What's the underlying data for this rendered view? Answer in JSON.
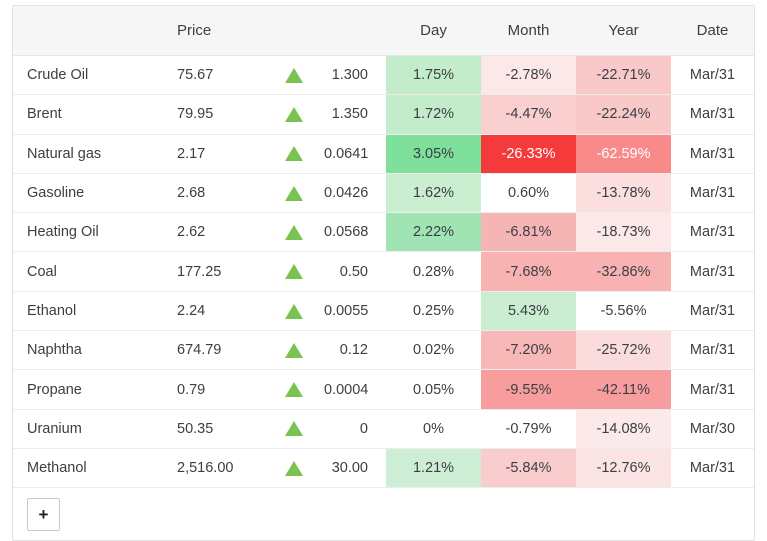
{
  "table": {
    "headers": {
      "name": "",
      "price": "Price",
      "arrow": "",
      "change": "",
      "day": "Day",
      "month": "Month",
      "year": "Year",
      "date": "Date"
    },
    "rows": [
      {
        "name": "Crude Oil",
        "price": "75.67",
        "direction": "up",
        "change": "1.300",
        "day": "1.75%",
        "month": "-2.78%",
        "year": "-22.71%",
        "date": "Mar/31",
        "day_bg": "#c3ecca",
        "month_bg": "#fce8e8",
        "year_bg": "#f9c9c9",
        "day_fg": "#3a3f44",
        "month_fg": "#3a3f44",
        "year_fg": "#3a3f44"
      },
      {
        "name": "Brent",
        "price": "79.95",
        "direction": "up",
        "change": "1.350",
        "day": "1.72%",
        "month": "-4.47%",
        "year": "-22.24%",
        "date": "Mar/31",
        "day_bg": "#c3ecca",
        "month_bg": "#f9cfcf",
        "year_bg": "#f9c9c9",
        "day_fg": "#3a3f44",
        "month_fg": "#3a3f44",
        "year_fg": "#3a3f44"
      },
      {
        "name": "Natural gas",
        "price": "2.17",
        "direction": "up",
        "change": "0.0641",
        "day": "3.05%",
        "month": "-26.33%",
        "year": "-62.59%",
        "date": "Mar/31",
        "day_bg": "#7ee09a",
        "month_bg": "#f43a3a",
        "year_bg": "#f98a8a",
        "day_fg": "#3a3f44",
        "month_fg": "#ffffff",
        "year_fg": "#ffffff"
      },
      {
        "name": "Gasoline",
        "price": "2.68",
        "direction": "up",
        "change": "0.0426",
        "day": "1.62%",
        "month": "0.60%",
        "year": "-13.78%",
        "date": "Mar/31",
        "day_bg": "#c9eed0",
        "month_bg": "#ffffff",
        "year_bg": "#fbdede",
        "day_fg": "#3a3f44",
        "month_fg": "#3a3f44",
        "year_fg": "#3a3f44"
      },
      {
        "name": "Heating Oil",
        "price": "2.62",
        "direction": "up",
        "change": "0.0568",
        "day": "2.22%",
        "month": "-6.81%",
        "year": "-18.73%",
        "date": "Mar/31",
        "day_bg": "#9fe4b2",
        "month_bg": "#f6b5b5",
        "year_bg": "#fce8e8",
        "day_fg": "#3a3f44",
        "month_fg": "#3a3f44",
        "year_fg": "#3a3f44"
      },
      {
        "name": "Coal",
        "price": "177.25",
        "direction": "up",
        "change": "0.50",
        "day": "0.28%",
        "month": "-7.68%",
        "year": "-32.86%",
        "date": "Mar/31",
        "day_bg": "#ffffff",
        "month_bg": "#f8b2b2",
        "year_bg": "#f8b2b2",
        "day_fg": "#3a3f44",
        "month_fg": "#3a3f44",
        "year_fg": "#3a3f44"
      },
      {
        "name": "Ethanol",
        "price": "2.24",
        "direction": "up",
        "change": "0.0055",
        "day": "0.25%",
        "month": "5.43%",
        "year": "-5.56%",
        "date": "Mar/31",
        "day_bg": "#ffffff",
        "month_bg": "#cbeed3",
        "year_bg": "#ffffff",
        "day_fg": "#3a3f44",
        "month_fg": "#3a3f44",
        "year_fg": "#3a3f44"
      },
      {
        "name": "Naphtha",
        "price": "674.79",
        "direction": "up",
        "change": "0.12",
        "day": "0.02%",
        "month": "-7.20%",
        "year": "-25.72%",
        "date": "Mar/31",
        "day_bg": "#ffffff",
        "month_bg": "#f8b8b8",
        "year_bg": "#fbdcdc",
        "day_fg": "#3a3f44",
        "month_fg": "#3a3f44",
        "year_fg": "#3a3f44"
      },
      {
        "name": "Propane",
        "price": "0.79",
        "direction": "up",
        "change": "0.0004",
        "day": "0.05%",
        "month": "-9.55%",
        "year": "-42.11%",
        "date": "Mar/31",
        "day_bg": "#ffffff",
        "month_bg": "#f89d9d",
        "year_bg": "#f89d9d",
        "day_fg": "#3a3f44",
        "month_fg": "#3a3f44",
        "year_fg": "#3a3f44"
      },
      {
        "name": "Uranium",
        "price": "50.35",
        "direction": "up",
        "change": "0",
        "day": "0%",
        "month": "-0.79%",
        "year": "-14.08%",
        "date": "Mar/30",
        "day_bg": "#ffffff",
        "month_bg": "#ffffff",
        "year_bg": "#fce9e9",
        "day_fg": "#3a3f44",
        "month_fg": "#3a3f44",
        "year_fg": "#3a3f44"
      },
      {
        "name": "Methanol",
        "price": "2,516.00",
        "direction": "up",
        "change": "30.00",
        "day": "1.21%",
        "month": "-5.84%",
        "year": "-12.76%",
        "date": "Mar/31",
        "day_bg": "#cdeed5",
        "month_bg": "#f9cdcd",
        "year_bg": "#fce4e4",
        "day_fg": "#3a3f44",
        "month_fg": "#3a3f44",
        "year_fg": "#3a3f44"
      }
    ],
    "add_button_label": "+"
  },
  "colors": {
    "arrow_up": "#7ac252",
    "arrow_down": "#e04f4f",
    "header_bg": "#f6f6f6",
    "border": "#e2e2e2"
  }
}
